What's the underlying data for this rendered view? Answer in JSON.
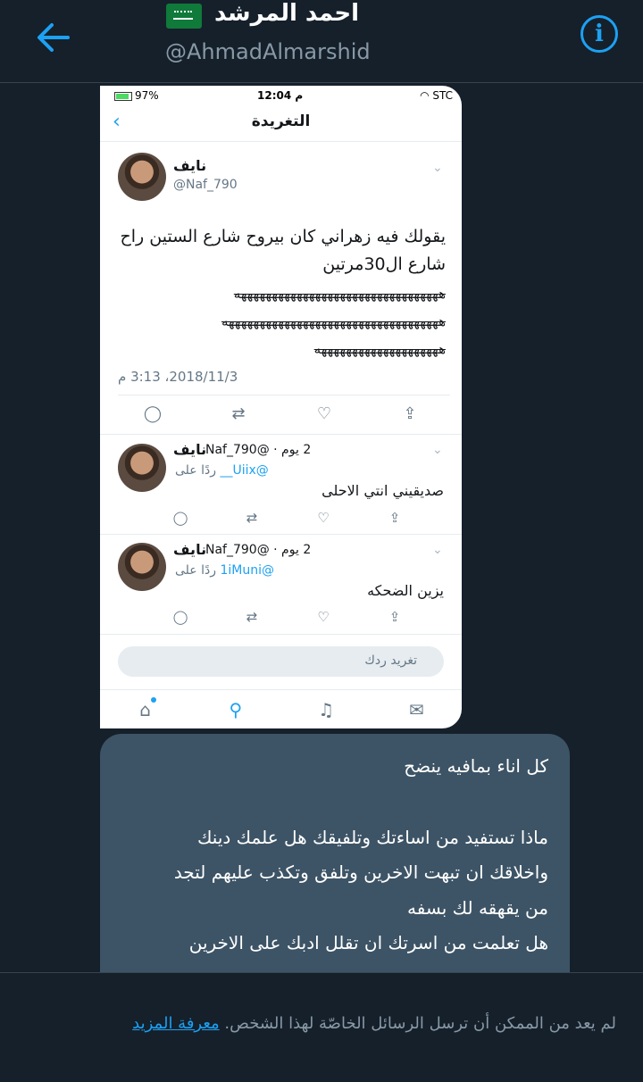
{
  "header": {
    "name": "احمد المرشد",
    "handle": "@AhmadAlmarshid"
  },
  "screenshot": {
    "status": {
      "battery": "97%",
      "time": "12:04 م",
      "carrier": "STC"
    },
    "nav_title": "التغريدة",
    "tweet": {
      "name": "نايف",
      "handle": "@Naf_790",
      "text": "يقولك فيه زهراني كان بيروح شارع الستين راح شارع ال30مرتين",
      "laugh_lines": [
        "هههههههههههههههههههههههههههههههههه",
        "هههههههههههههههههههههههههههههههههههه",
        "ههههههههههههههههههههه"
      ],
      "timestamp": "2018/11/3، 3:13 م"
    },
    "replies": [
      {
        "name": "نايف",
        "meta": "2 يوم · @Naf_790",
        "reply_prefix": "ردًا على",
        "reply_to": "@Uiix__",
        "text": "صديقيني انتي الاحلى"
      },
      {
        "name": "نايف",
        "meta": "2 يوم · @Naf_790",
        "reply_prefix": "ردًا على",
        "reply_to": "@1iMuni",
        "text": "يزين الضحكه"
      }
    ],
    "compose_placeholder": "تغريد ردك",
    "tabs": [
      "home-icon",
      "search-icon",
      "bell-icon",
      "mail-icon"
    ]
  },
  "message": {
    "lines": [
      "كل اناء بمافيه ينضح",
      "",
      "ماذا تستفيد من اساءتك وتلفيقك هل علمك دينك",
      "واخلاقك ان تبهت الاخرين وتلفق وتكذب عليهم لتجد",
      "من يقهقه لك بسفه",
      "هل تعلمت من اسرتك ان تقلل ادبك على الاخرين"
    ]
  },
  "footer": {
    "notice": "لم يعد من الممكن أن ترسل الرسائل الخاصّة لهذا الشخص.",
    "link": "معرفة المزيد"
  },
  "colors": {
    "background": "#15202b",
    "accent": "#1da1f2",
    "bubble": "#3d5466"
  }
}
